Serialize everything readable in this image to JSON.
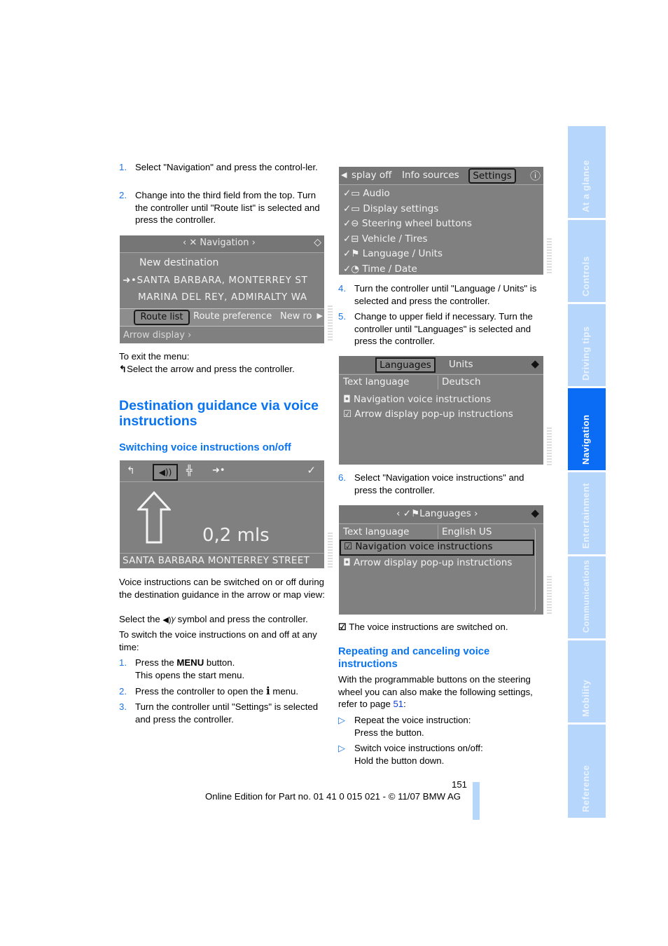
{
  "left_column": {
    "steps_top": [
      {
        "num": "1.",
        "text": "Select \"Navigation\" and press the control-ler."
      },
      {
        "num": "2.",
        "text": "Change into the third field from the top. Turn the controller until \"Route list\" is selected and press the controller."
      }
    ],
    "nav_screen": {
      "header": "Navigation",
      "items": [
        "New destination",
        "SANTA BARBARA, MONTERREY ST",
        "MARINA DEL REY, ADMIRALTY WA"
      ],
      "tabs": [
        "Route list",
        "Route preference",
        "New ro"
      ],
      "footer": "Arrow display"
    },
    "exit_label": "To exit the menu:",
    "exit_text": "Select the arrow and press the controller.",
    "section_title": "Destination guidance via voice instructions",
    "subsection_title": "Switching voice instructions on/off",
    "arrow_screen": {
      "distance": "0,2 mls",
      "street": "SANTA BARBARA MONTERREY STREET"
    },
    "para1": "Voice instructions can be switched on or off during the destination guidance in the arrow or map view:",
    "para2_pre": "Select the",
    "para2_post": "symbol and press the controller.",
    "para3": "To switch the voice instructions on and off at any time:",
    "steps_bottom": [
      {
        "num": "1.",
        "pre": "Press the",
        "bold": "MENU",
        "post": "button.",
        "line2": "This opens the start menu."
      },
      {
        "num": "2.",
        "pre": "Press the controller to open the",
        "bold": "i",
        "post": "menu."
      },
      {
        "num": "3.",
        "text": "Turn the controller until \"Settings\" is selected and press the controller."
      }
    ]
  },
  "right_column": {
    "settings_screen": {
      "tabs": [
        "splay off",
        "Info sources",
        "Settings"
      ],
      "items": [
        "Audio",
        "Display settings",
        "Steering wheel buttons",
        "Vehicle / Tires",
        "Language / Units",
        "Time / Date"
      ]
    },
    "steps_mid": [
      {
        "num": "4.",
        "text": "Turn the controller until \"Language / Units\" is selected and press the controller."
      },
      {
        "num": "5.",
        "text": "Change to upper field if necessary. Turn the controller until \"Languages\" is selected and press the controller."
      }
    ],
    "languages_screen_1": {
      "tabs": [
        "Languages",
        "Units"
      ],
      "text_language_label": "Text language",
      "text_language_value": "Deutsch",
      "options": [
        {
          "label": "Navigation voice instructions",
          "checked": false
        },
        {
          "label": "Arrow display pop-up instructions",
          "checked": true
        }
      ]
    },
    "step6": {
      "num": "6.",
      "text": "Select \"Navigation voice instructions\" and press the controller."
    },
    "languages_screen_2": {
      "header": "Languages",
      "text_language_label": "Text language",
      "text_language_value": "English US",
      "options": [
        {
          "label": "Navigation voice instructions",
          "checked": true
        },
        {
          "label": "Arrow display pop-up instructions",
          "checked": false
        }
      ]
    },
    "switched_on_text": "The voice instructions are switched on.",
    "section_title": "Repeating and canceling voice instructions",
    "para": "With the programmable buttons on the steering wheel you can also make the following settings, refer to page",
    "page_link": "51",
    "bullets": [
      {
        "line1": "Repeat the voice instruction:",
        "line2": "Press the button."
      },
      {
        "line1": "Switch voice instructions on/off:",
        "line2": "Hold the button down."
      }
    ]
  },
  "side_tabs": [
    {
      "label": "At a glance",
      "active": false
    },
    {
      "label": "Controls",
      "active": false
    },
    {
      "label": "Driving tips",
      "active": false
    },
    {
      "label": "Navigation",
      "active": true
    },
    {
      "label": "Entertainment",
      "active": false
    },
    {
      "label": "Communications",
      "active": false
    },
    {
      "label": "Mobility",
      "active": false
    },
    {
      "label": "Reference",
      "active": false
    }
  ],
  "footer": {
    "page_number": "151",
    "edition": "Online Edition for Part no. 01 41 0 015 021 - © 11/07 BMW AG"
  },
  "colors": {
    "accent": "#0a74f0",
    "tab_active": "#0a6cf5",
    "tab_inactive": "#b7d6fb",
    "screen_gray": "#808080"
  }
}
